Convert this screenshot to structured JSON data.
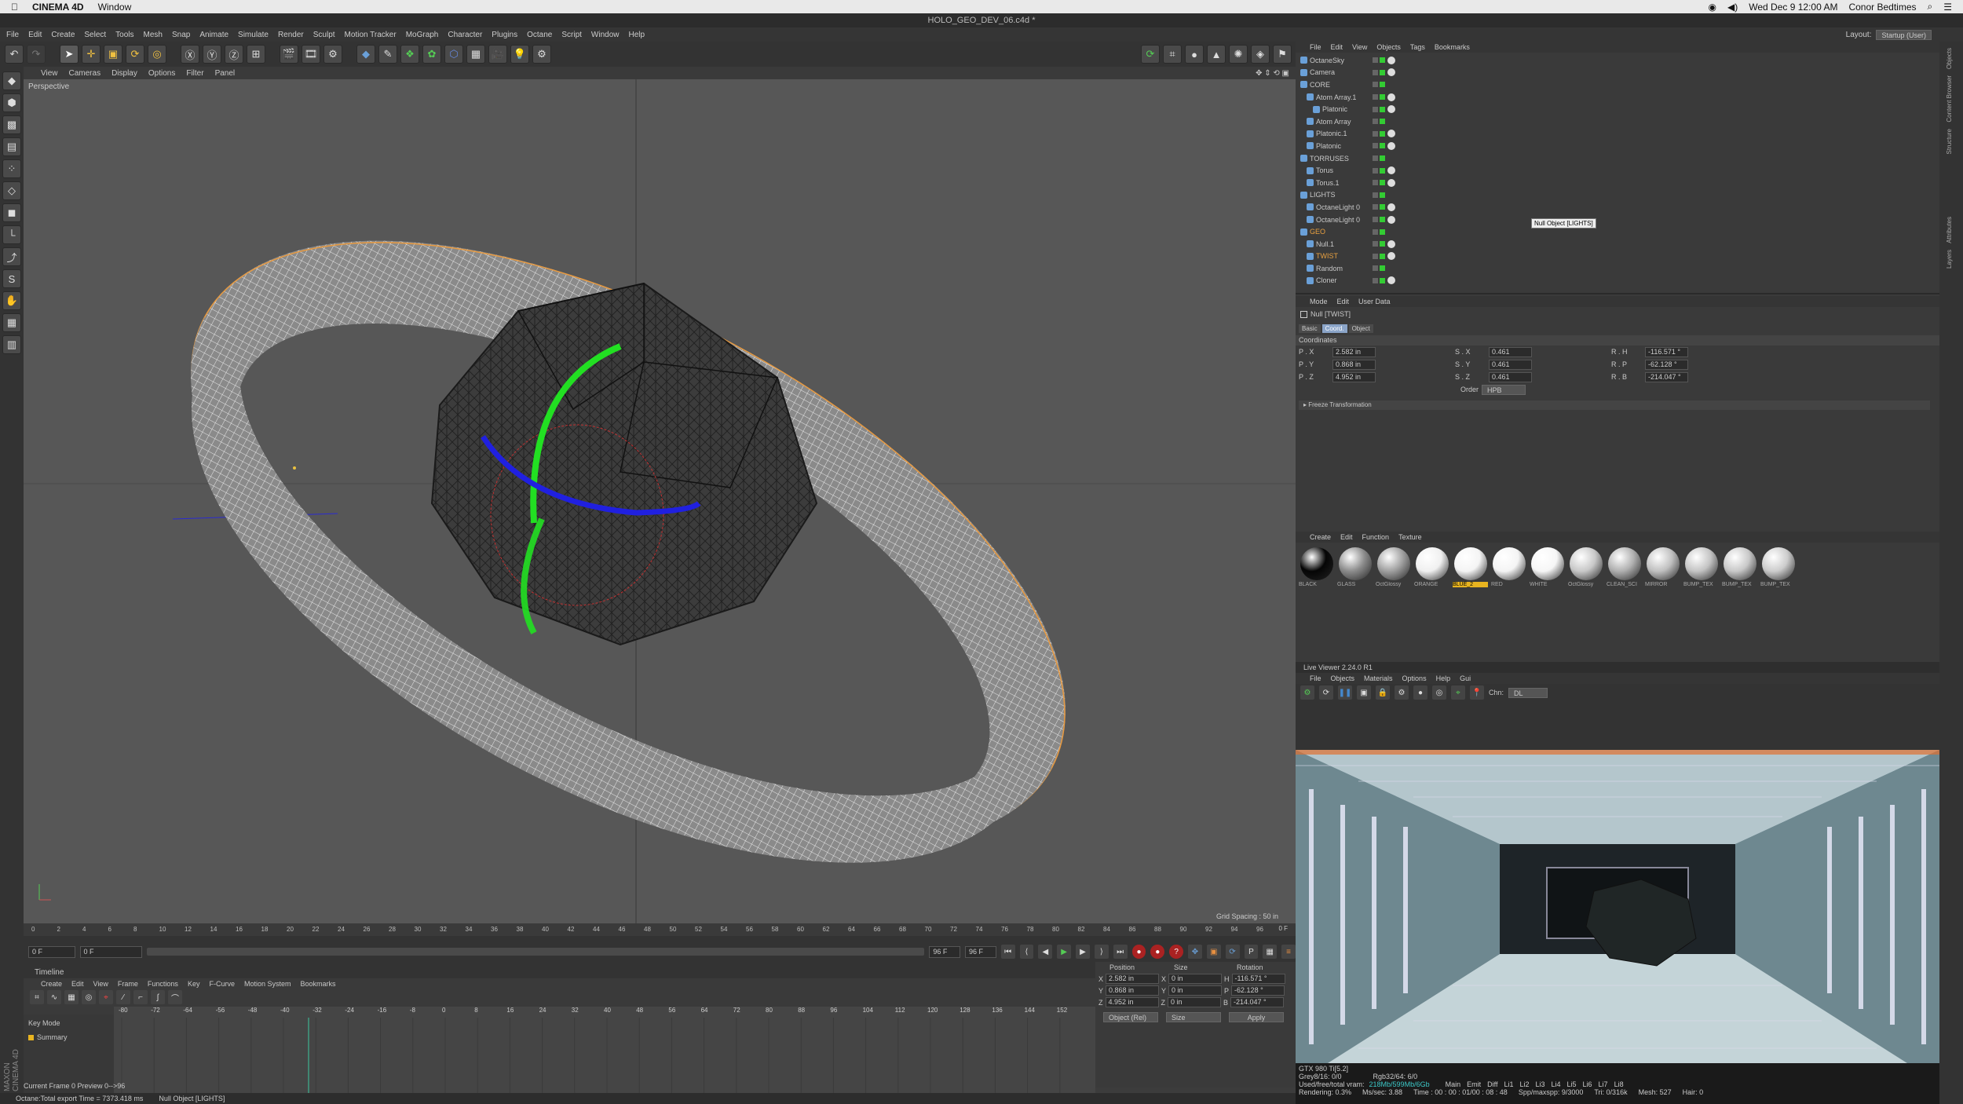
{
  "mac_menu": {
    "apple": "",
    "app": "CINEMA 4D",
    "window": "Window",
    "clock": "Wed Dec 9  12:00 AM",
    "user": "Conor Bedtimes"
  },
  "window_title": "HOLO_GEO_DEV_06.c4d *",
  "main_menu": [
    "File",
    "Edit",
    "Create",
    "Select",
    "Tools",
    "Mesh",
    "Snap",
    "Animate",
    "Simulate",
    "Render",
    "Sculpt",
    "Motion Tracker",
    "MoGraph",
    "Character",
    "Plugins",
    "Octane",
    "Script",
    "Window",
    "Help"
  ],
  "layout": {
    "label": "Layout:",
    "value": "Startup (User)"
  },
  "viewport": {
    "menu": [
      "View",
      "Cameras",
      "Display",
      "Options",
      "Filter",
      "Panel"
    ],
    "label": "Perspective",
    "grid_spacing": "Grid Spacing : 50 in"
  },
  "ruler_ticks": [
    "0",
    "2",
    "4",
    "6",
    "8",
    "10",
    "12",
    "14",
    "16",
    "18",
    "20",
    "22",
    "24",
    "26",
    "28",
    "30",
    "32",
    "34",
    "36",
    "38",
    "40",
    "42",
    "44",
    "46",
    "48",
    "50",
    "52",
    "54",
    "56",
    "58",
    "60",
    "62",
    "64",
    "66",
    "68",
    "70",
    "72",
    "74",
    "76",
    "78",
    "80",
    "82",
    "84",
    "86",
    "88",
    "90",
    "92",
    "94",
    "96"
  ],
  "ruler_end": "0 F",
  "framebar": {
    "current": "0 F",
    "start": "0 F",
    "end_a": "96 F",
    "end_b": "96 F"
  },
  "timeline": {
    "title": "Timeline",
    "menu": [
      "Create",
      "Edit",
      "View",
      "Frame",
      "Functions",
      "Key",
      "F-Curve",
      "Motion System",
      "Bookmarks"
    ],
    "mode": "Key Mode",
    "summary": "Summary",
    "ticks": [
      "-80",
      "-72",
      "-64",
      "-56",
      "-48",
      "-40",
      "-32",
      "-24",
      "-16",
      "-8",
      "0",
      "8",
      "16",
      "24",
      "32",
      "40",
      "48",
      "56",
      "64",
      "72",
      "80",
      "88",
      "96",
      "104",
      "112",
      "120",
      "128",
      "136",
      "144",
      "152"
    ],
    "status_left": "Current Frame  0  Preview  0-->96"
  },
  "coord_manager": {
    "headers": [
      "Position",
      "Size",
      "Rotation"
    ],
    "rows": [
      {
        "axis": "X",
        "pos": "2.582 in",
        "size_axis": "X",
        "size": "0 in",
        "rot_axis": "H",
        "rot": "-116.571 °"
      },
      {
        "axis": "Y",
        "pos": "0.868 in",
        "size_axis": "Y",
        "size": "0 in",
        "rot_axis": "P",
        "rot": "-62.128 °"
      },
      {
        "axis": "Z",
        "pos": "4.952 in",
        "size_axis": "Z",
        "size": "0 in",
        "rot_axis": "B",
        "rot": "-214.047 °"
      }
    ],
    "mode": "Object (Rel)",
    "size_mode": "Size",
    "apply": "Apply"
  },
  "statusbar": {
    "left": "Octane:Total export Time = 7373.418 ms",
    "right": "Null Object [LIGHTS]"
  },
  "object_manager": {
    "menu": [
      "File",
      "Edit",
      "View",
      "Objects",
      "Tags",
      "Bookmarks"
    ],
    "objects": [
      {
        "name": "OctaneSky",
        "indent": 0,
        "color": "#c8c8c8"
      },
      {
        "name": "Camera",
        "indent": 0,
        "color": "#c8c8c8"
      },
      {
        "name": "CORE",
        "indent": 0,
        "color": "#c8c8c8"
      },
      {
        "name": "Atom Array.1",
        "indent": 1,
        "color": "#c8c8c8"
      },
      {
        "name": "Platonic",
        "indent": 2,
        "color": "#c8c8c8"
      },
      {
        "name": "Atom Array",
        "indent": 1,
        "color": "#c8c8c8"
      },
      {
        "name": "Platonic.1",
        "indent": 1,
        "color": "#c8c8c8"
      },
      {
        "name": "Platonic",
        "indent": 1,
        "color": "#c8c8c8"
      },
      {
        "name": "TORRUSES",
        "indent": 0,
        "color": "#c8c8c8"
      },
      {
        "name": "Torus",
        "indent": 1,
        "color": "#c8c8c8"
      },
      {
        "name": "Torus.1",
        "indent": 1,
        "color": "#c8c8c8"
      },
      {
        "name": "LIGHTS",
        "indent": 0,
        "color": "#c8c8c8"
      },
      {
        "name": "OctaneLight 0",
        "indent": 1,
        "color": "#c8c8c8"
      },
      {
        "name": "OctaneLight 0",
        "indent": 1,
        "color": "#c8c8c8"
      },
      {
        "name": "GEO",
        "indent": 0,
        "color": "#e8a040"
      },
      {
        "name": "Null.1",
        "indent": 1,
        "color": "#c8c8c8"
      },
      {
        "name": "TWIST",
        "indent": 1,
        "color": "#e8a040"
      },
      {
        "name": "Random",
        "indent": 1,
        "color": "#c8c8c8"
      },
      {
        "name": "Cloner",
        "indent": 1,
        "color": "#c8c8c8"
      }
    ],
    "tooltip": "Null Object [LIGHTS]"
  },
  "attribute_manager": {
    "menu": [
      "Mode",
      "Edit",
      "User Data"
    ],
    "title": "Null [TWIST]",
    "tabs": [
      "Basic",
      "Coord.",
      "Object"
    ],
    "section": "Coordinates",
    "rows": [
      {
        "p_label": "P . X",
        "p": "2.582 in",
        "s_label": "S . X",
        "s": "0.461",
        "r_label": "R . H",
        "r": "-116.571 °"
      },
      {
        "p_label": "P . Y",
        "p": "0.868 in",
        "s_label": "S . Y",
        "s": "0.461",
        "r_label": "R . P",
        "r": "-62.128 °"
      },
      {
        "p_label": "P . Z",
        "p": "4.952 in",
        "s_label": "S . Z",
        "s": "0.461",
        "r_label": "R . B",
        "r": "-214.047 °"
      }
    ],
    "order_label": "Order",
    "order_value": "HPB",
    "freeze": "▸ Freeze Transformation"
  },
  "material_manager": {
    "menu": [
      "Create",
      "Edit",
      "Function",
      "Texture"
    ],
    "materials": [
      {
        "name": "BLACK",
        "color": "#050505"
      },
      {
        "name": "GLASS",
        "color": "#8c8c8c"
      },
      {
        "name": "OctGlossy",
        "color": "#a0a0a0"
      },
      {
        "name": "ORANGE",
        "color": "#f0f0f0"
      },
      {
        "name": "BLUE_2",
        "color": "#f4f4f4"
      },
      {
        "name": "RED",
        "color": "#f4f4f4"
      },
      {
        "name": "WHITE",
        "color": "#f6f6f6"
      },
      {
        "name": "OctGlossy",
        "color": "#c8c8c8"
      },
      {
        "name": "CLEAN_SCI",
        "color": "#b0b0b0"
      },
      {
        "name": "MIRROR",
        "color": "#c0c0c0"
      },
      {
        "name": "BUMP_TEX",
        "color": "#c4c4c4"
      },
      {
        "name": "BUMP_TEX",
        "color": "#c8c8c8"
      },
      {
        "name": "BUMP_TEX",
        "color": "#cccccc"
      }
    ],
    "highlight_index": 4
  },
  "live_viewer": {
    "title": "Live Viewer 2.24.0 R1",
    "menu": [
      "File",
      "Objects",
      "Materials",
      "Options",
      "Help",
      "Gui"
    ],
    "chn_label": "Chn:",
    "chn_value": "DL",
    "gpu": "GTX 980 Ti[5.2]",
    "grey": "Grey8/16: 0/0",
    "rgb": "Rgb32/64: 6/0",
    "vram_label": "Used/free/total vram:",
    "vram": "218Mb/599Mb/6Gb",
    "tabs": [
      "Main",
      "Emit",
      "Diff",
      "Li1",
      "Li2",
      "Li3",
      "Li4",
      "Li5",
      "Li6",
      "Li7",
      "Li8"
    ],
    "rendering": "Rendering: 0.3%",
    "mssec": "Ms/sec: 3.88",
    "time": "Time : 00 : 00 : 01/00 : 08 : 48",
    "spp": "Spp/maxspp: 9/3000",
    "tri": "Tri: 0/316k",
    "mesh": "Mesh: 527",
    "hair": "Hair: 0"
  }
}
